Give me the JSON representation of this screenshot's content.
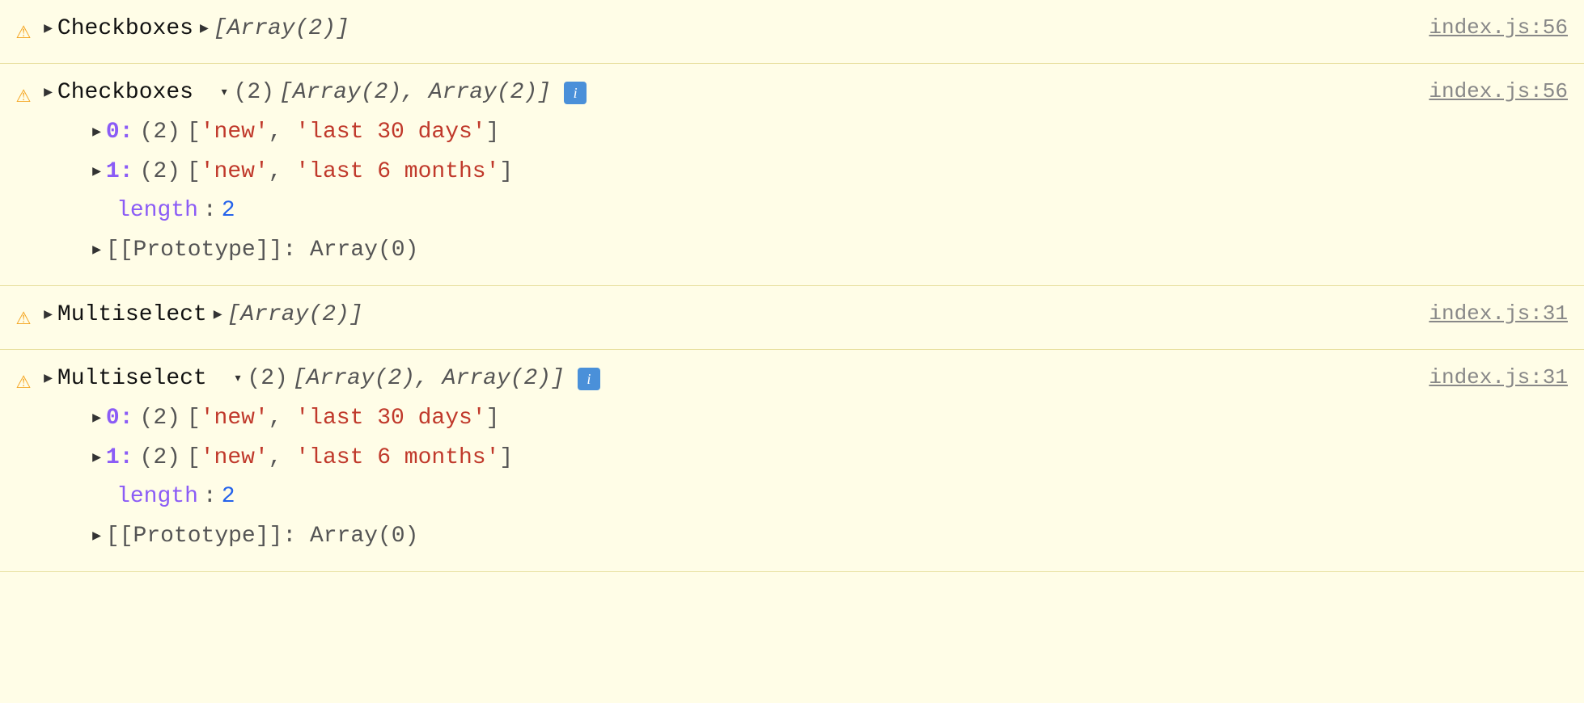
{
  "console": {
    "rows": [
      {
        "id": "row1",
        "warning": "⚠",
        "collapsed": true,
        "label": "Checkboxes",
        "arrow": "▶",
        "value_italic": "[Array(2)]",
        "file_link": "index.js:56"
      },
      {
        "id": "row2",
        "warning": "⚠",
        "collapsed": false,
        "label": "Checkboxes",
        "arrow_down": "▾",
        "count": "(2)",
        "value_italic": "[Array(2), Array(2)]",
        "info": "i",
        "file_link": "index.js:56",
        "children": [
          {
            "index": "0:",
            "count": "(2)",
            "values": [
              "'new'",
              "'last 30 days'"
            ]
          },
          {
            "index": "1:",
            "count": "(2)",
            "values": [
              "'new'",
              "'last 6 months'"
            ]
          }
        ],
        "length_label": "length",
        "length_value": "2",
        "prototype": "[[Prototype]]: Array(0)"
      },
      {
        "id": "row3",
        "warning": "⚠",
        "collapsed": true,
        "label": "Multiselect",
        "arrow": "▶",
        "value_italic": "[Array(2)]",
        "file_link": "index.js:31"
      },
      {
        "id": "row4",
        "warning": "⚠",
        "collapsed": false,
        "label": "Multiselect",
        "arrow_down": "▾",
        "count": "(2)",
        "value_italic": "[Array(2), Array(2)]",
        "info": "i",
        "file_link": "index.js:31",
        "children": [
          {
            "index": "0:",
            "count": "(2)",
            "values": [
              "'new'",
              "'last 30 days'"
            ]
          },
          {
            "index": "1:",
            "count": "(2)",
            "values": [
              "'new'",
              "'last 6 months'"
            ]
          }
        ],
        "length_label": "length",
        "length_value": "2",
        "prototype": "[[Prototype]]: Array(0)"
      }
    ]
  }
}
